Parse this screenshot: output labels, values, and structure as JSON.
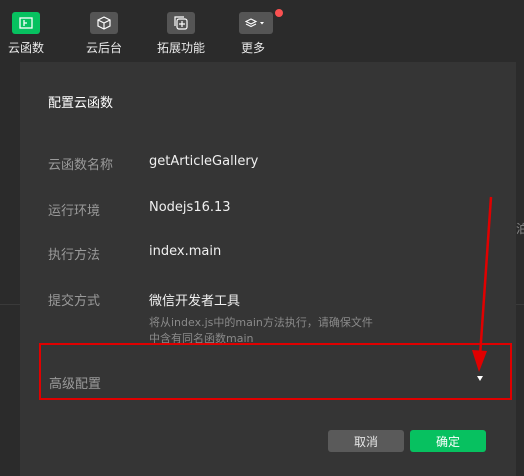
{
  "toolbar": {
    "items": [
      {
        "label": "云函数",
        "icon": "cloud-function-icon",
        "active": true
      },
      {
        "label": "云后台",
        "icon": "cube-icon",
        "active": false
      },
      {
        "label": "拓展功能",
        "icon": "plus-box-icon",
        "active": false
      },
      {
        "label": "更多",
        "icon": "layers-icon",
        "active": false,
        "badge": true
      }
    ]
  },
  "dialog": {
    "title": "配置云函数",
    "rows": [
      {
        "label": "云函数名称",
        "value": "getArticleGallery"
      },
      {
        "label": "运行环境",
        "value": "Nodejs16.13"
      },
      {
        "label": "执行方法",
        "value": "index.main"
      },
      {
        "label": "提交方式",
        "value": "微信开发者工具"
      }
    ],
    "hint": "将从index.js中的main方法执行，请确保文件中含有同名函数main",
    "advanced": {
      "label": "高级配置"
    },
    "buttons": {
      "cancel": "取消",
      "confirm": "确定"
    }
  },
  "colors": {
    "accent": "#07c160",
    "highlight": "#e00000",
    "badge": "#fa5151"
  }
}
